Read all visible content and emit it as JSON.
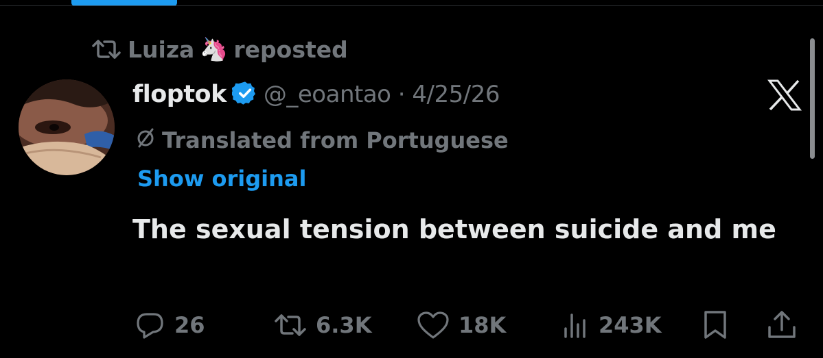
{
  "repost": {
    "user": "Luiza",
    "emoji": "🦄",
    "label": "reposted"
  },
  "tweet": {
    "display_name": "floptok",
    "verified": true,
    "handle_date": "@_eoantao · 4/25/26",
    "translation_note": "Translated from Portuguese",
    "show_original_label": "Show original",
    "text": "The sexual tension between suicide and me"
  },
  "actions": {
    "replies": "26",
    "reposts": "6.3K",
    "likes": "18K",
    "views": "243K"
  },
  "icons": {
    "repost": "repost-icon",
    "verified": "verified-badge-icon",
    "brand": "x-logo-icon",
    "translate": "translate-icon",
    "reply": "reply-icon",
    "like": "heart-icon",
    "views": "views-icon",
    "bookmark": "bookmark-icon",
    "share": "share-icon"
  },
  "colors": {
    "background": "#000000",
    "text_primary": "#e7e9ea",
    "text_secondary": "#71767b",
    "accent": "#1d9bf0",
    "scrollbar": "#8b8d90"
  }
}
